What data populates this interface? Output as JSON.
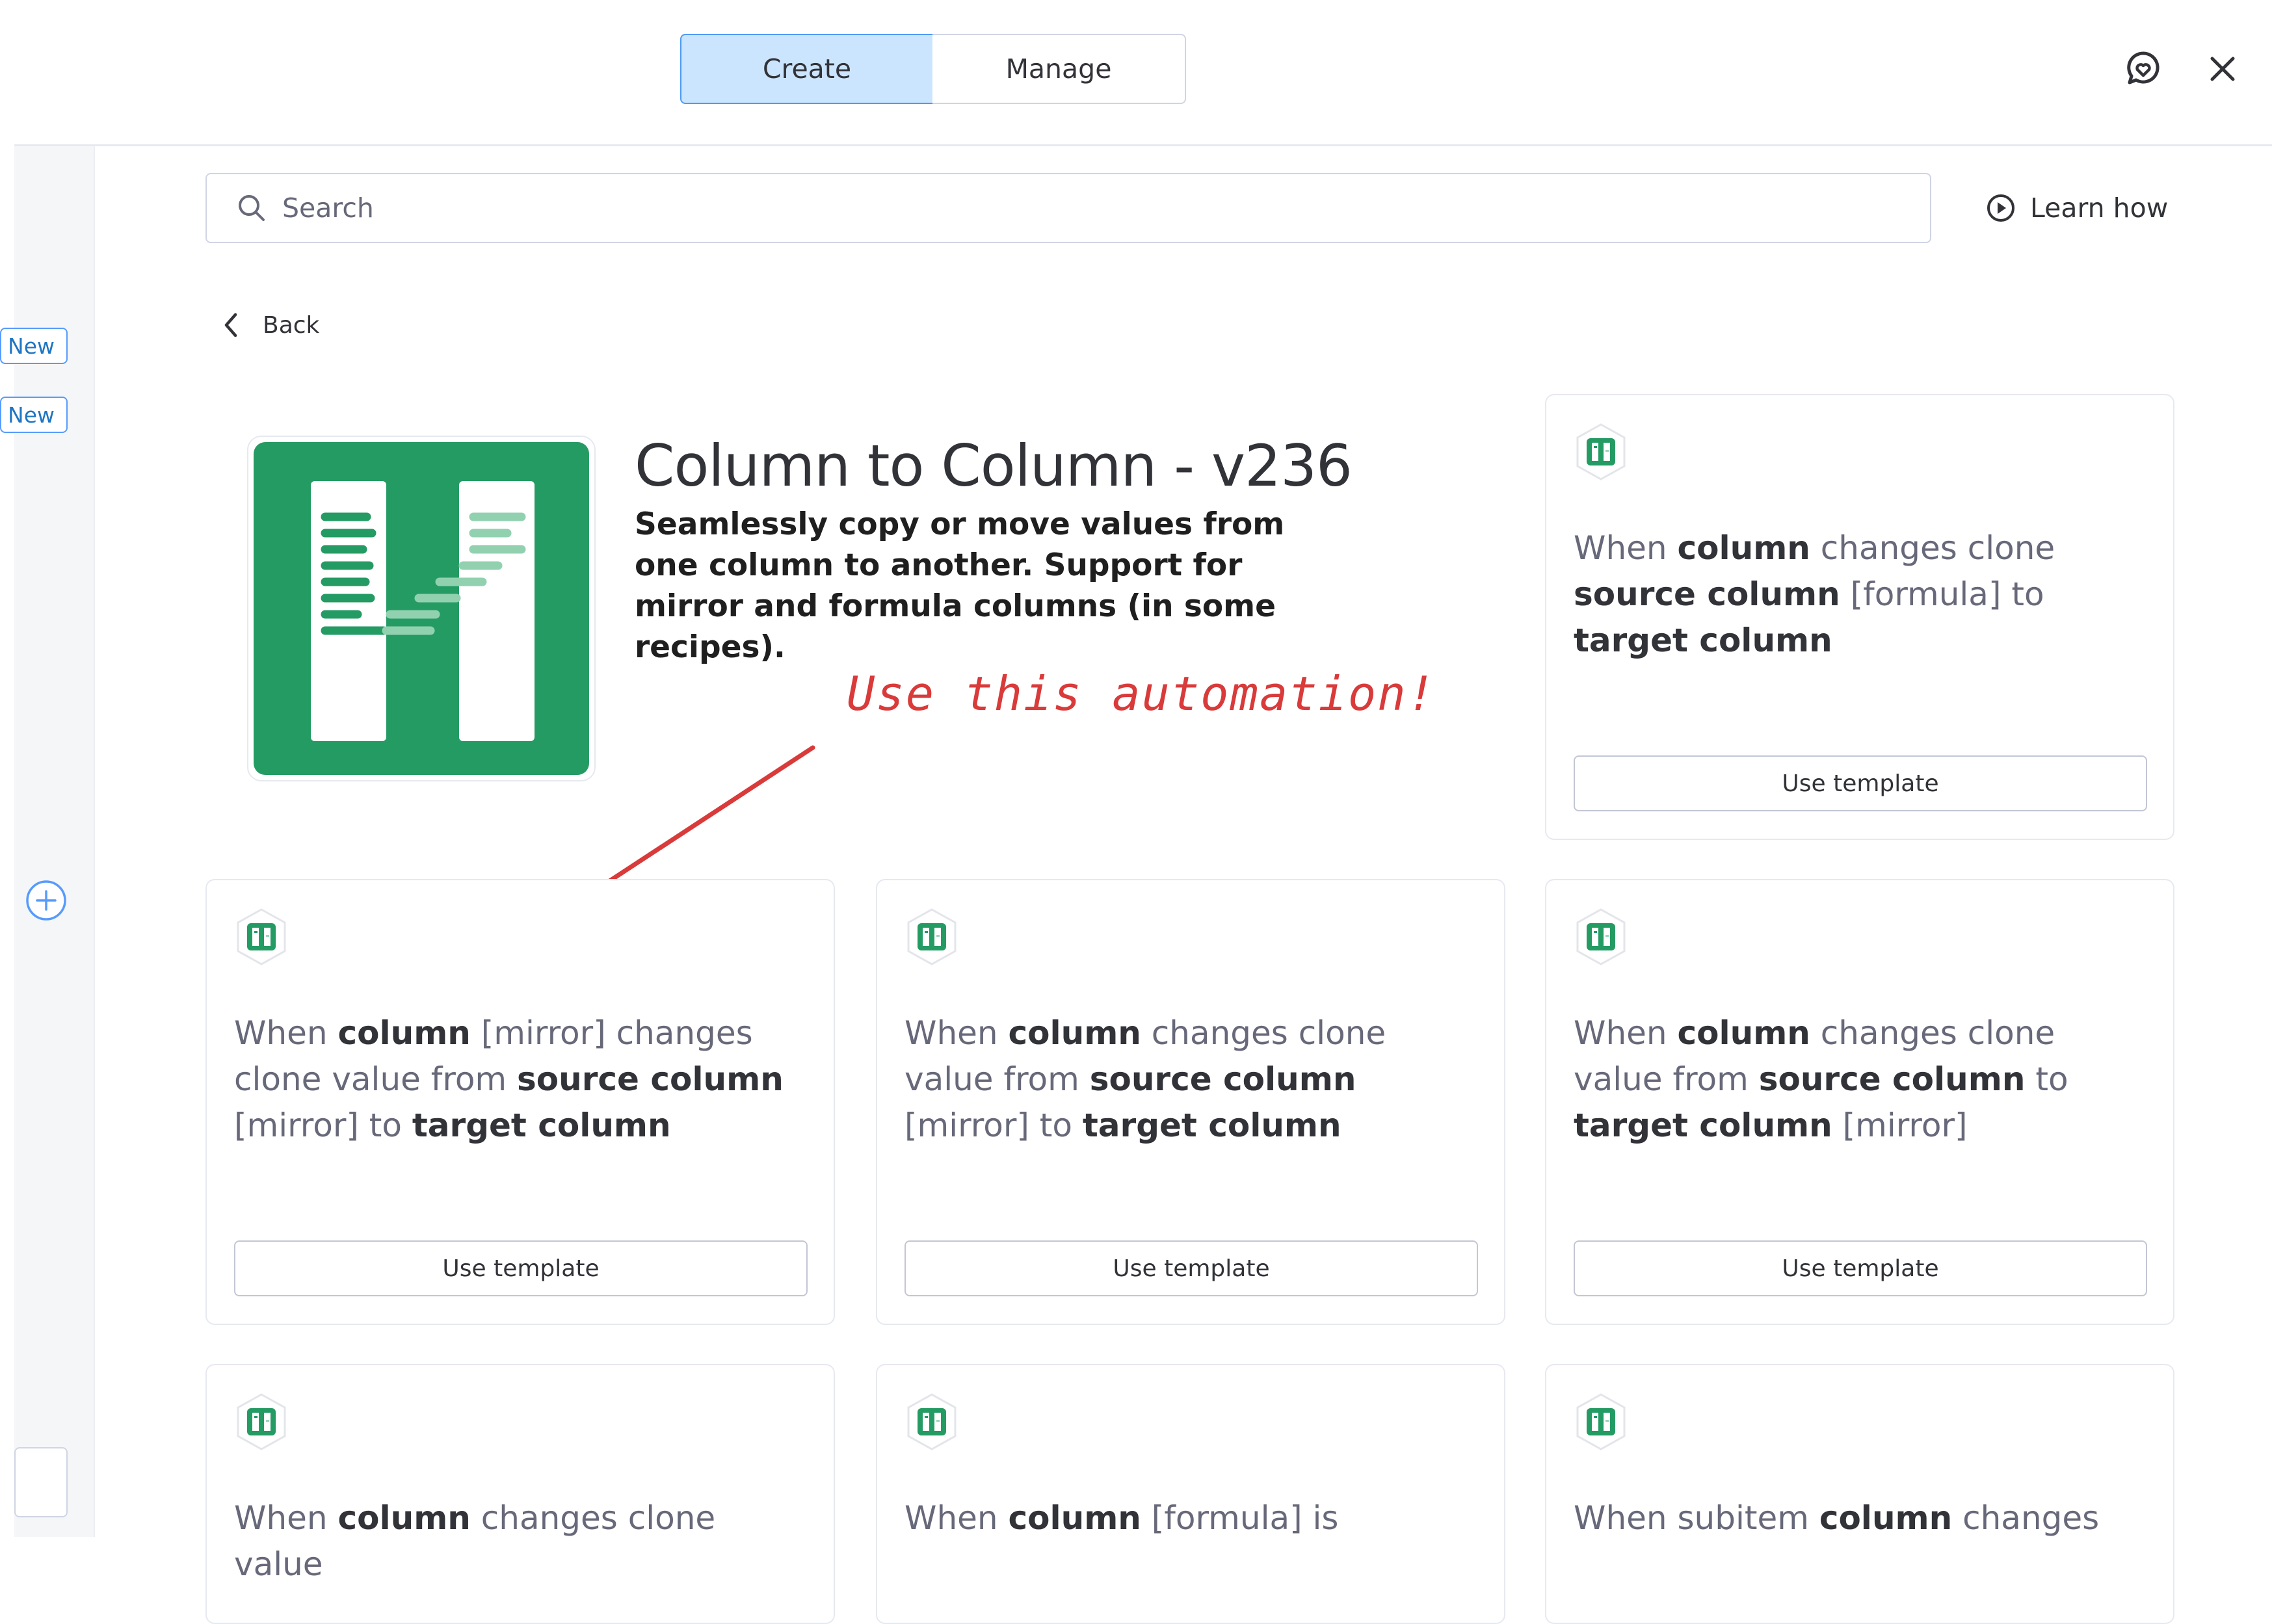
{
  "header": {
    "tabs": [
      {
        "label": "Create",
        "active": true
      },
      {
        "label": "Manage",
        "active": false
      }
    ],
    "feedback_icon": "chat-heart-icon",
    "close_icon": "close-icon"
  },
  "sidebar": {
    "badges": [
      "New",
      "New"
    ],
    "add_icon": "plus-circle-icon"
  },
  "search": {
    "placeholder": "Search"
  },
  "learn_how": {
    "label": "Learn how"
  },
  "back": {
    "label": "Back"
  },
  "app": {
    "title": "Column to Column - v236",
    "description": "Seamlessly copy or move values from one column to another. Support for mirror and formula columns (in some recipes).",
    "accent_color": "#259b64"
  },
  "annotation": {
    "text": "Use this automation!",
    "color": "#d93a3a"
  },
  "cards": [
    {
      "text": [
        "When ",
        {
          "b": "column"
        },
        " changes clone ",
        {
          "b": "source column"
        },
        " [formula] to ",
        {
          "b": "target column"
        }
      ],
      "button": "Use template"
    },
    {
      "text": [
        "When ",
        {
          "b": "column"
        },
        " [mirror] changes clone value from ",
        {
          "b": "source column"
        },
        " [mirror] to ",
        {
          "b": "target column"
        }
      ],
      "button": "Use template"
    },
    {
      "text": [
        "When ",
        {
          "b": "column"
        },
        " changes clone value from ",
        {
          "b": "source column"
        },
        " [mirror] to ",
        {
          "b": "target column"
        }
      ],
      "button": "Use template"
    },
    {
      "text": [
        "When ",
        {
          "b": "column"
        },
        " changes clone value from ",
        {
          "b": "source column"
        },
        " to ",
        {
          "b": "target column"
        },
        " [mirror]"
      ],
      "button": "Use template"
    },
    {
      "text": [
        "When ",
        {
          "b": "column"
        },
        " changes clone value"
      ],
      "button": ""
    },
    {
      "text": [
        "When ",
        {
          "b": "column"
        },
        " [formula] is"
      ],
      "button": ""
    },
    {
      "text": [
        "When subitem ",
        {
          "b": "column"
        },
        " changes"
      ],
      "button": ""
    }
  ]
}
